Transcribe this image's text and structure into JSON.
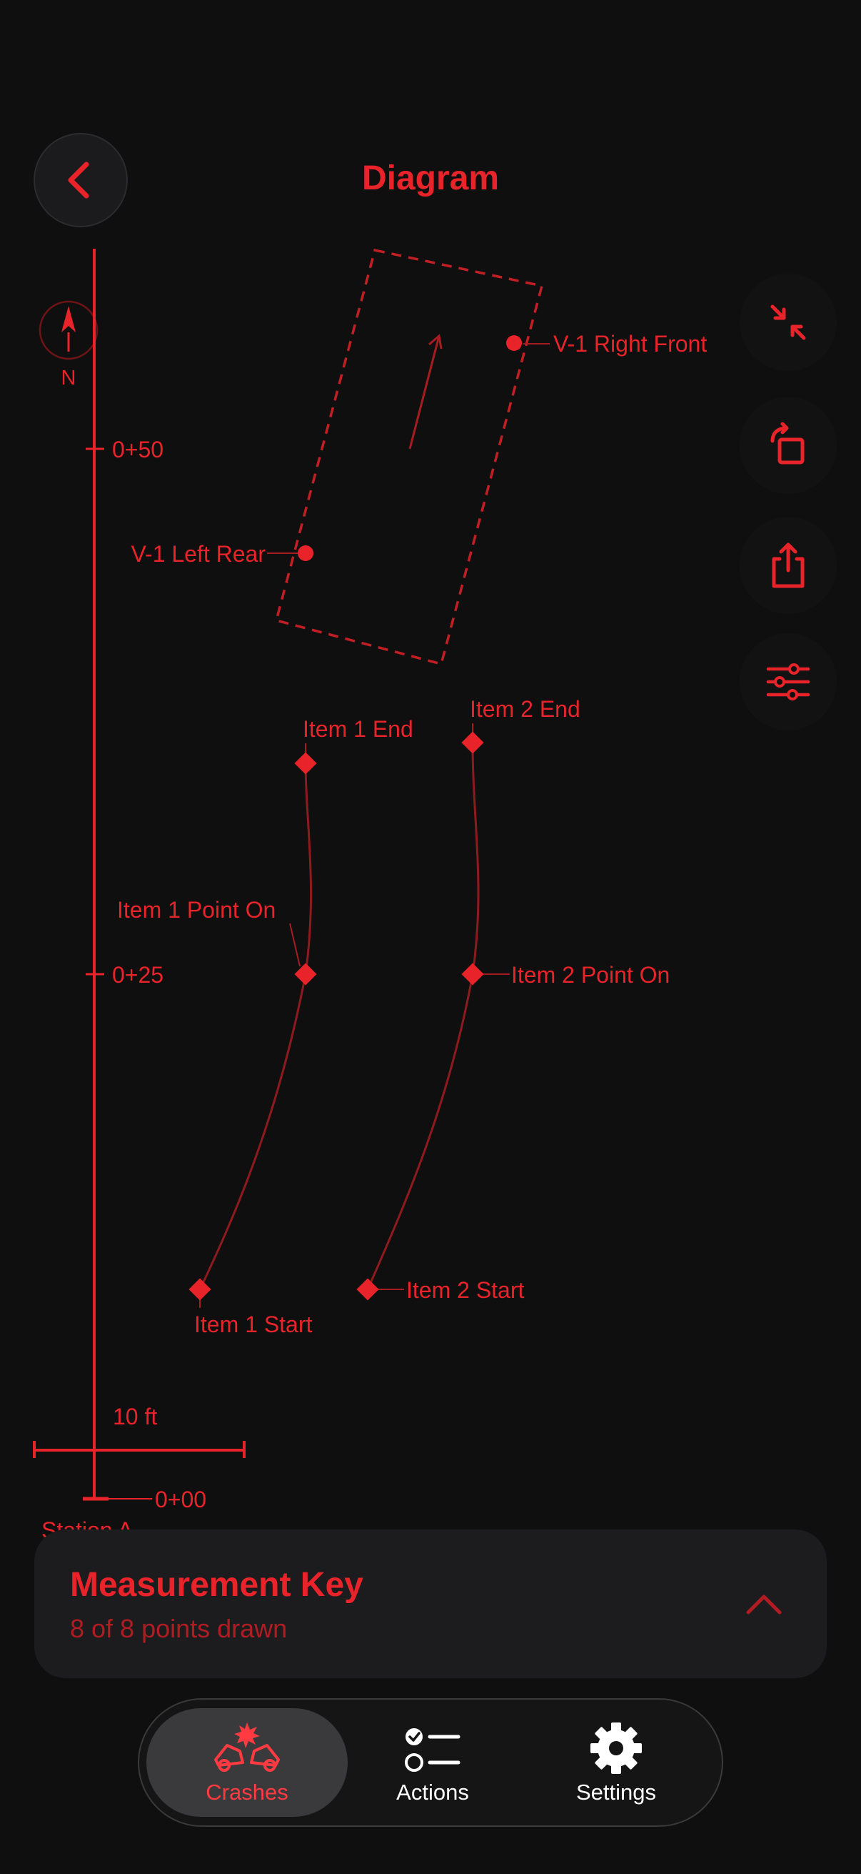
{
  "header": {
    "title": "Diagram"
  },
  "compass": {
    "label": "N"
  },
  "baseline": {
    "stations": [
      {
        "label": "0+50"
      },
      {
        "label": "0+25"
      },
      {
        "label": "0+00"
      }
    ],
    "scale_label": "10 ft",
    "station_name": "Station A"
  },
  "points": {
    "v1_right_front": "V-1 Right Front",
    "v1_left_rear": "V-1 Left Rear",
    "item1_end": "Item 1 End",
    "item2_end": "Item 2 End",
    "item1_point_on": "Item 1 Point On",
    "item2_point_on": "Item 2 Point On",
    "item1_start": "Item 1 Start",
    "item2_start": "Item 2 Start"
  },
  "side_actions": [
    {
      "icon": "collapse-arrows-icon"
    },
    {
      "icon": "rotate-icon"
    },
    {
      "icon": "share-icon"
    },
    {
      "icon": "sliders-icon"
    }
  ],
  "measurement_key": {
    "title": "Measurement Key",
    "subtitle": "8 of 8 points drawn"
  },
  "tabs": [
    {
      "label": "Crashes",
      "icon": "crash-icon",
      "active": true
    },
    {
      "label": "Actions",
      "icon": "checklist-icon",
      "active": false
    },
    {
      "label": "Settings",
      "icon": "gear-icon",
      "active": false
    }
  ],
  "colors": {
    "accent": "#e8232a",
    "background": "#0f0f10",
    "panel": "#1c1c1e"
  }
}
